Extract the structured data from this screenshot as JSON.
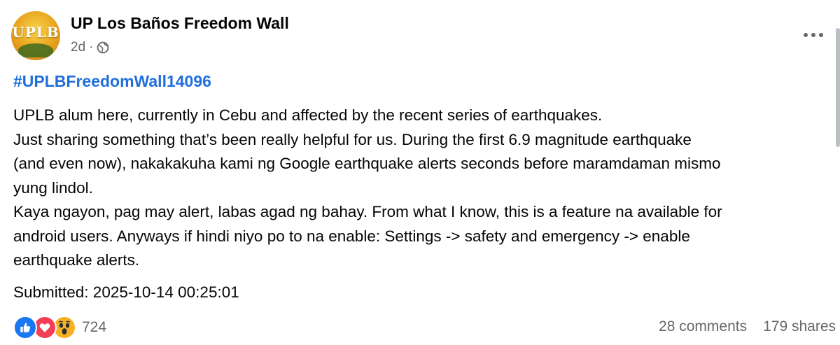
{
  "post": {
    "page_name": "UP Los Baños Freedom Wall",
    "avatar_text": "UPLB",
    "time_ago": "2d",
    "separator": "·",
    "privacy_icon": "globe-icon",
    "more_icon": "more-options-icon",
    "hashtag": "#UPLBFreedomWall14096",
    "body_lines": [
      "UPLB alum here, currently in Cebu and affected by the recent series of earthquakes.",
      "Just sharing something that’s been really helpful for us. During the first 6.9 magnitude earthquake",
      "(and even now), nakakakuha kami ng Google earthquake alerts seconds before maramdaman mismo",
      "yung lindol.",
      "Kaya ngayon, pag may alert, labas agad ng bahay. From what I know, this is a feature na available for",
      "android users. Anyways if hindi niyo po to na enable: Settings -> safety and emergency -> enable",
      "earthquake alerts."
    ],
    "submitted": "Submitted: 2025-10-14 00:25:01"
  },
  "engagement": {
    "reaction_icons": [
      "like-icon",
      "love-icon",
      "wow-icon"
    ],
    "reaction_count": "724",
    "comments": "28 comments",
    "shares": "179 shares"
  },
  "colors": {
    "link_blue": "#216fdb",
    "secondary_text": "#65676b",
    "like_blue": "#1877f2",
    "love_red": "#f33e58",
    "wow_yellow": "#f7b125"
  }
}
